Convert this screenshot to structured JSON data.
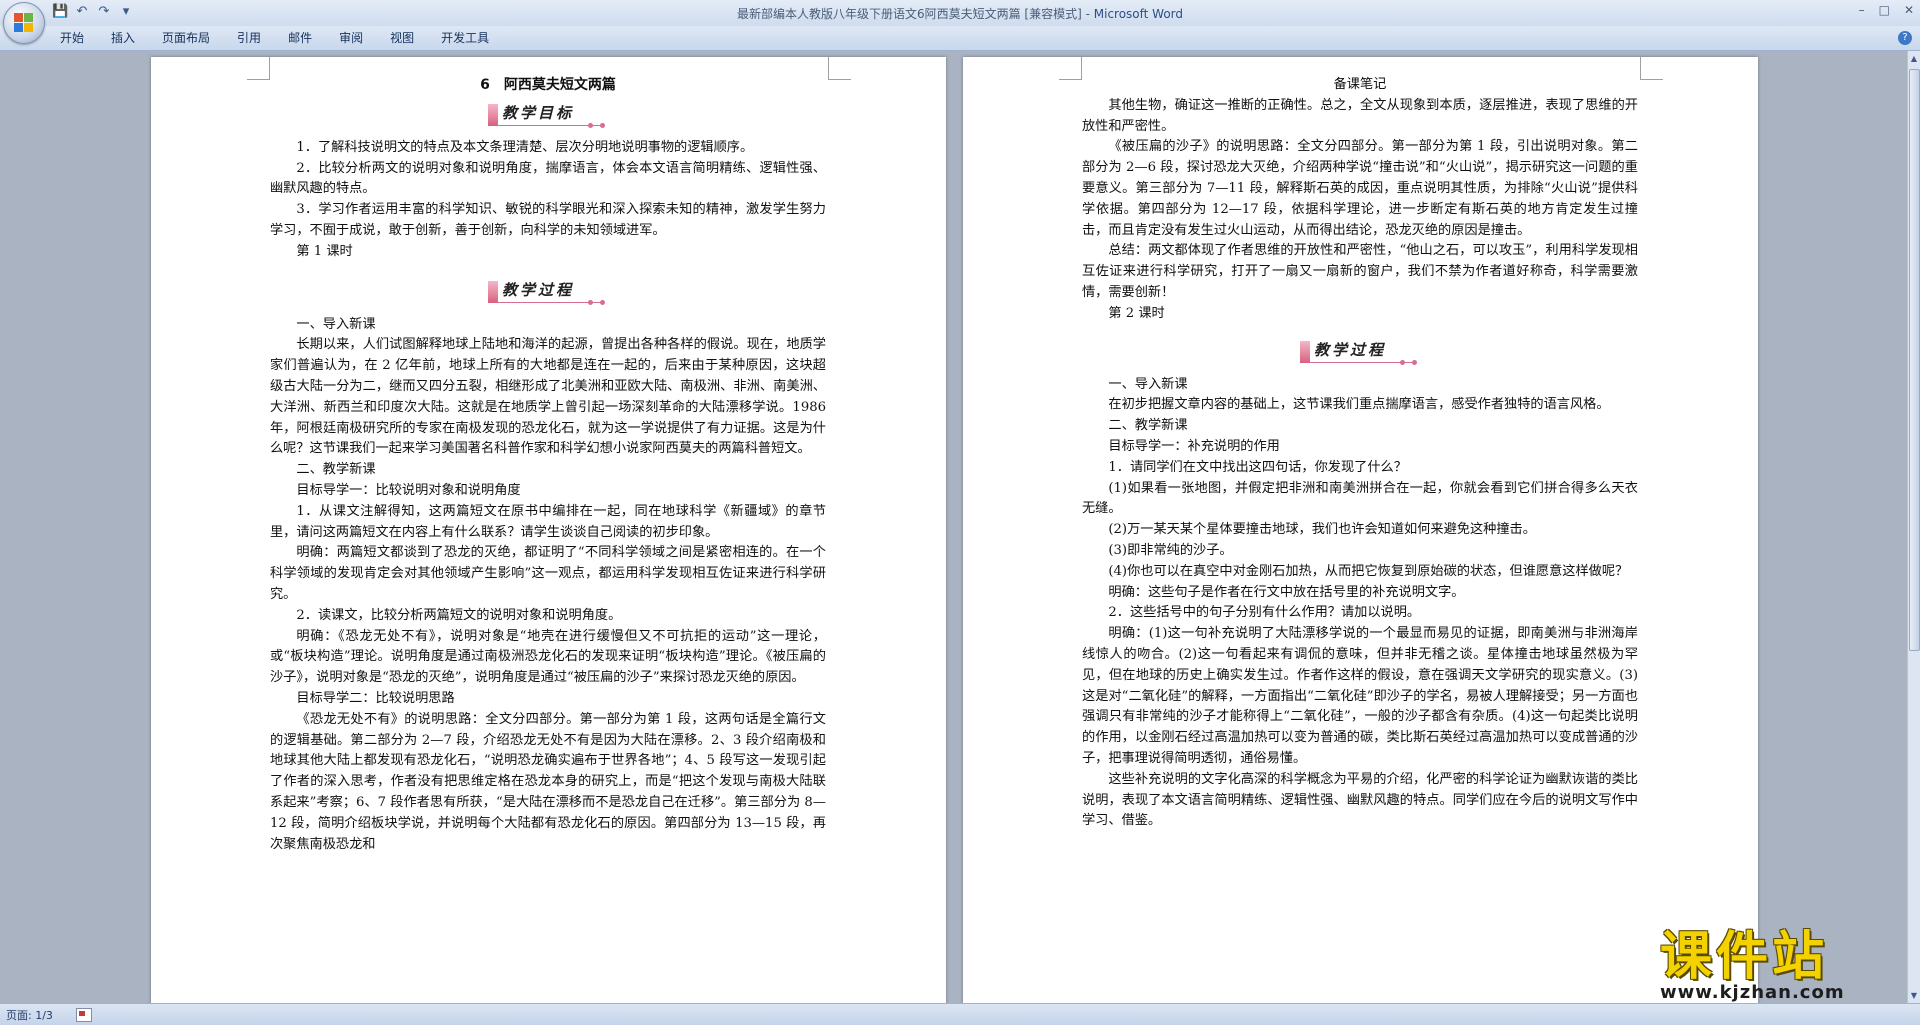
{
  "window": {
    "title_doc": "最新部编本人教版八年级下册语文6阿西莫夫短文两篇 [兼容模式]",
    "title_sep": " - ",
    "title_app": "Microsoft Word"
  },
  "quick_access": {
    "save": "💾",
    "undo": "↶",
    "redo": "↷",
    "more": "▾"
  },
  "ribbon": {
    "tabs": [
      "开始",
      "插入",
      "页面布局",
      "引用",
      "邮件",
      "审阅",
      "视图",
      "开发工具"
    ],
    "help": "?"
  },
  "left_page": {
    "title": "6　阿西莫夫短文两篇",
    "banner1": "教学目标",
    "goals": [
      "1．了解科技说明文的特点及本文条理清楚、层次分明地说明事物的逻辑顺序。",
      "2．比较分析两文的说明对象和说明角度，揣摩语言，体会本文语言简明精练、逻辑性强、幽默风趣的特点。",
      "3．学习作者运用丰富的科学知识、敏锐的科学眼光和深入探索未知的精神，激发学生努力学习，不囿于成说，敢于创新，善于创新，向科学的未知领域进军。"
    ],
    "lesson1": "第 1 课时",
    "banner2": "教学过程",
    "paras": [
      "一、导入新课",
      "长期以来，人们试图解释地球上陆地和海洋的起源，曾提出各种各样的假说。现在，地质学家们普遍认为，在 2 亿年前，地球上所有的大地都是连在一起的，后来由于某种原因，这块超级古大陆一分为二，继而又四分五裂，相继形成了北美洲和亚欧大陆、南极洲、非洲、南美洲、大洋洲、新西兰和印度次大陆。这就是在地质学上曾引起一场深刻革命的大陆漂移学说。1986 年，阿根廷南极研究所的专家在南极发现的恐龙化石，就为这一学说提供了有力证据。这是为什么呢？这节课我们一起来学习美国著名科普作家和科学幻想小说家阿西莫夫的两篇科普短文。",
      "二、教学新课",
      "目标导学一：比较说明对象和说明角度",
      "1．从课文注解得知，这两篇短文在原书中编排在一起，同在地球科学《新疆域》的章节里，请问这两篇短文在内容上有什么联系？请学生谈谈自己阅读的初步印象。",
      "明确：两篇短文都谈到了恐龙的灭绝，都证明了“不同科学领域之间是紧密相连的。在一个科学领域的发现肯定会对其他领域产生影响”这一观点，都运用科学发现相互佐证来进行科学研究。",
      "2．读课文，比较分析两篇短文的说明对象和说明角度。",
      "明确：《恐龙无处不有》，说明对象是“地壳在进行缓慢但又不可抗拒的运动”这一理论，或“板块构造”理论。说明角度是通过南极洲恐龙化石的发现来证明“板块构造”理论。《被压扁的沙子》，说明对象是“恐龙的灭绝”，说明角度是通过“被压扁的沙子”来探讨恐龙灭绝的原因。",
      "目标导学二：比较说明思路",
      "《恐龙无处不有》的说明思路：全文分四部分。第一部分为第 1 段，这两句话是全篇行文的逻辑基础。第二部分为 2—7 段，介绍恐龙无处不有是因为大陆在漂移。2、3 段介绍南极和地球其他大陆上都发现有恐龙化石，“说明恐龙确实遍布于世界各地”；4、5 段写这一发现引起了作者的深入思考，作者没有把思维定格在恐龙本身的研究上，而是“把这个发现与南极大陆联系起来”考察；6、7 段作者思有所获，“是大陆在漂移而不是恐龙自己在迁移”。第三部分为 8—12 段，简明介绍板块学说，并说明每个大陆都有恐龙化石的原因。第四部分为 13—15 段，再次聚焦南极恐龙和"
    ]
  },
  "right_page": {
    "header": "备课笔记",
    "paras_a": [
      "其他生物，确证这一推断的正确性。总之，全文从现象到本质，逐层推进，表现了思维的开放性和严密性。",
      "《被压扁的沙子》的说明思路：全文分四部分。第一部分为第 1 段，引出说明对象。第二部分为 2—6 段，探讨恐龙大灭绝，介绍两种学说“撞击说”和“火山说”，揭示研究这一问题的重要意义。第三部分为 7—11 段，解释斯石英的成因，重点说明其性质，为排除“火山说”提供科学依据。第四部分为 12—17 段，依据科学理论，进一步断定有斯石英的地方肯定发生过撞击，而且肯定没有发生过火山运动，从而得出结论，恐龙灭绝的原因是撞击。",
      "总结：两文都体现了作者思维的开放性和严密性，“他山之石，可以攻玉”，利用科学发现相互佐证来进行科学研究，打开了一扇又一扇新的窗户，我们不禁为作者道好称奇，科学需要激情，需要创新！",
      "第 2 课时"
    ],
    "banner": "教学过程",
    "paras_b": [
      "一、导入新课",
      "在初步把握文章内容的基础上，这节课我们重点揣摩语言，感受作者独特的语言风格。",
      "二、教学新课",
      "目标导学一：补充说明的作用",
      "1．请同学们在文中找出这四句话，你发现了什么？",
      "(1)如果看一张地图，并假定把非洲和南美洲拼合在一起，你就会看到它们拼合得多么天衣无缝。",
      "(2)万一某天某个星体要撞击地球，我们也许会知道如何来避免这种撞击。",
      "(3)即非常纯的沙子。",
      "(4)你也可以在真空中对金刚石加热，从而把它恢复到原始碳的状态，但谁愿意这样做呢？",
      "明确：这些句子是作者在行文中放在括号里的补充说明文字。",
      "2．这些括号中的句子分别有什么作用？请加以说明。",
      "明确：(1)这一句补充说明了大陆漂移学说的一个最显而易见的证据，即南美洲与非洲海岸线惊人的吻合。(2)这一句看起来有调侃的意味，但并非无稽之谈。星体撞击地球虽然极为罕见，但在地球的历史上确实发生过。作者作这样的假设，意在强调天文学研究的现实意义。(3)这是对“二氧化硅”的解释，一方面指出“二氧化硅”即沙子的学名，易被人理解接受；另一方面也强调只有非常纯的沙子才能称得上“二氧化硅”，一般的沙子都含有杂质。(4)这一句起类比说明的作用，以金刚石经过高温加热可以变为普通的碳，类比斯石英经过高温加热可以变成普通的沙子，把事理说得简明透彻，通俗易懂。",
      "这些补充说明的文字化高深的科学概念为平易的介绍，化严密的科学论证为幽默诙谐的类比说明，表现了本文语言简明精练、逻辑性强、幽默风趣的特点。同学们应在今后的说明文写作中学习、借鉴。"
    ]
  },
  "status": {
    "page": "页面: 1/3"
  },
  "watermark": {
    "big": "课件站",
    "url": "www.kjzhan.com"
  },
  "colors": {
    "banner_pink": "#d86e8d",
    "watermark_yellow": "#f3d200",
    "ribbon_blue": "#c8d7ec"
  }
}
